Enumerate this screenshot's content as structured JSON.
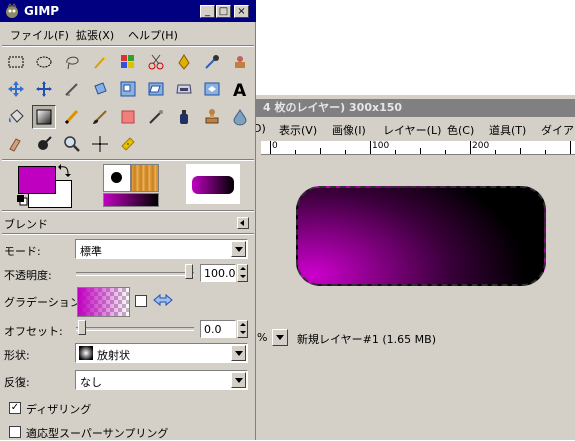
{
  "toolbox": {
    "title": "GIMP",
    "window_buttons": [
      "_",
      "□",
      "×"
    ],
    "menu": [
      "ファイル(F)",
      "拡張(X)",
      "ヘルプ(H)"
    ],
    "colors": {
      "foreground": "#c000c0",
      "background": "#ffffff"
    },
    "gradient_preview": {
      "from": "#c000c0",
      "to": "#000000"
    },
    "active_tool": "blend-tool"
  },
  "blend": {
    "header": "ブレンド",
    "mode_label": "モード:",
    "mode_value": "標準",
    "opacity_label": "不透明度:",
    "opacity_value": "100.0",
    "opacity_level": 1.0,
    "gradient_label": "グラデーション:",
    "offset_label": "オフセット:",
    "offset_value": "0.0",
    "offset_level": 0.0,
    "shape_label": "形状:",
    "shape_value": "放射状",
    "repeat_label": "反復:",
    "repeat_value": "なし",
    "dithering_label": "ディザリング",
    "dithering_checked": true,
    "adaptive_label": "適応型スーパーサンプリング",
    "adaptive_checked": false
  },
  "image_window": {
    "title": "4 枚のレイヤー) 300x150",
    "menu": [
      "D)",
      "表示(V)",
      "画像(I)",
      "レイヤー(L)",
      "色(C)",
      "道具(T)",
      "ダイアロ"
    ],
    "ruler_labels": [
      "0",
      "100",
      "200"
    ],
    "zoom_unit": "%",
    "status": "新規レイヤー#1 (1.65 MB)"
  }
}
